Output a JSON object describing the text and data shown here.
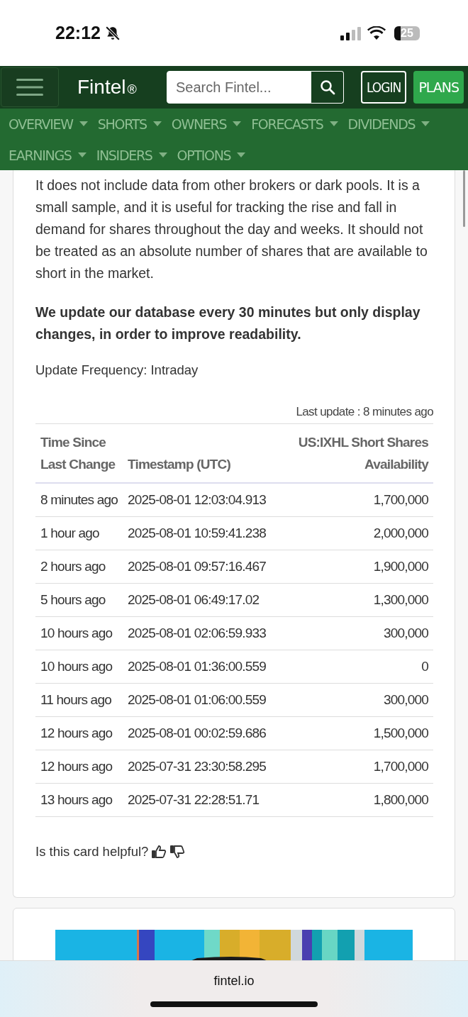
{
  "status_bar": {
    "time": "22:12",
    "battery": "25"
  },
  "header": {
    "logo": "Fintel",
    "registered": "®",
    "search": {
      "placeholder": "Search Fintel..."
    },
    "login": "LOGIN",
    "plans": "PLANS"
  },
  "nav": [
    {
      "label": "OVERVIEW"
    },
    {
      "label": "SHORTS"
    },
    {
      "label": "OWNERS"
    },
    {
      "label": "FORECASTS"
    },
    {
      "label": "DIVIDENDS"
    },
    {
      "label": "EARNINGS"
    },
    {
      "label": "INSIDERS"
    },
    {
      "label": "OPTIONS"
    }
  ],
  "card": {
    "paragraph": "It does not include data from other brokers or dark pools. It is a small sample, and it is useful for tracking the rise and fall in demand for shares throughout the day and weeks. It should not be treated as an absolute number of shares that are available to short in the market.",
    "notice": "We update our database every 30 minutes but only display changes, in order to improve readability.",
    "frequency": "Update Frequency: Intraday",
    "last_update": "Last update : 8 minutes ago",
    "table": {
      "columns": [
        "Time Since Last Change",
        "Timestamp (UTC)",
        "US:IXHL Short Shares Availability"
      ],
      "rows": [
        [
          "8 minutes ago",
          "2025-08-01 12:03:04.913",
          "1,700,000"
        ],
        [
          "1 hour ago",
          "2025-08-01 10:59:41.238",
          "2,000,000"
        ],
        [
          "2 hours ago",
          "2025-08-01 09:57:16.467",
          "1,900,000"
        ],
        [
          "5 hours ago",
          "2025-08-01 06:49:17.02",
          "1,300,000"
        ],
        [
          "10 hours ago",
          "2025-08-01 02:06:59.933",
          "300,000"
        ],
        [
          "10 hours ago",
          "2025-08-01 01:36:00.559",
          "0"
        ],
        [
          "11 hours ago",
          "2025-08-01 01:06:00.559",
          "300,000"
        ],
        [
          "12 hours ago",
          "2025-08-01 00:02:59.686",
          "1,500,000"
        ],
        [
          "12 hours ago",
          "2025-07-31 23:30:58.295",
          "1,700,000"
        ],
        [
          "13 hours ago",
          "2025-07-31 22:28:51.71",
          "1,800,000"
        ]
      ]
    },
    "feedback": "Is this card helpful?"
  },
  "browser": {
    "url": "fintel.io"
  }
}
